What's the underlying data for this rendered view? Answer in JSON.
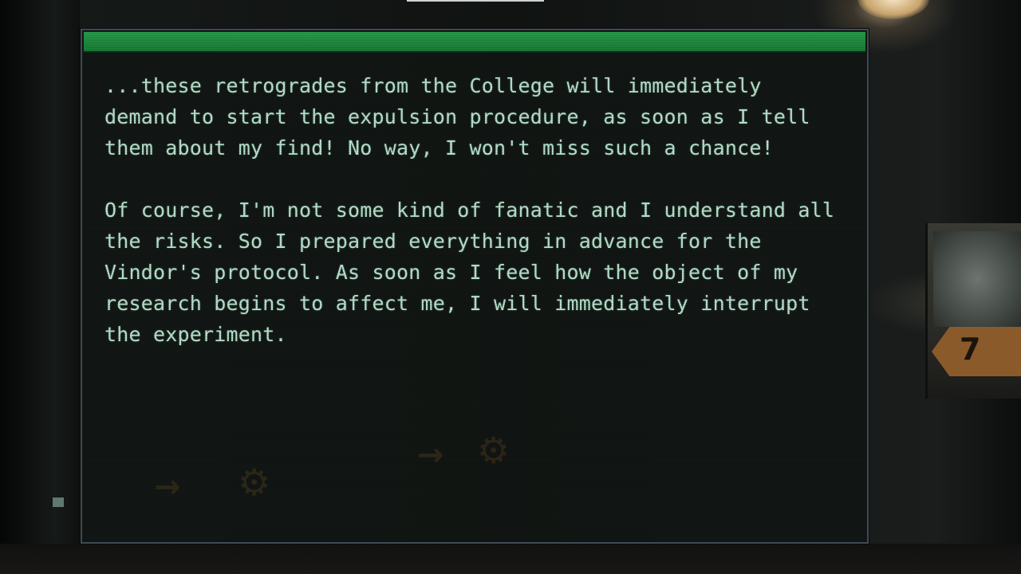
{
  "dialog": {
    "paragraphs": [
      "...these retrogrades from the College will immediately demand to start the expulsion procedure, as soon as I tell them about my find! No way, I won't miss such a chance!",
      "Of course, I'm not some kind of fanatic and I understand all the risks. So I prepared everything in advance for the Vindor's protocol. As soon as I feel how the object of my research begins to affect me, I will immediately interrupt the experiment."
    ]
  },
  "colors": {
    "header_green": "#1f8a3f",
    "text_mint": "#b7e0cc",
    "panel_border": "#3f4a52"
  },
  "background": {
    "sign_number": "7"
  }
}
